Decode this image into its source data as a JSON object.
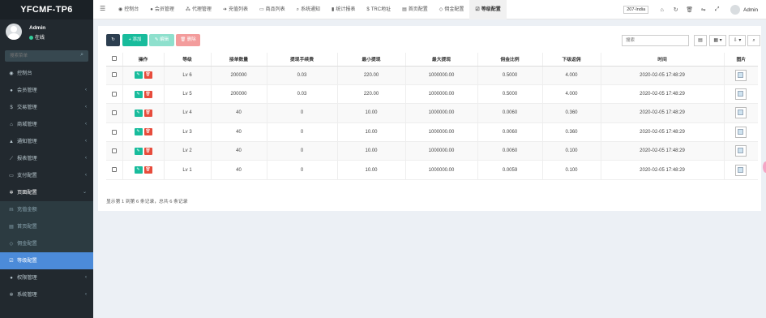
{
  "app": {
    "logo": "YFCMF-TP6"
  },
  "user": {
    "name": "Admin",
    "status": "在线"
  },
  "sidebar": {
    "search_placeholder": "搜索菜单",
    "items": [
      {
        "label": "控制台",
        "icon": "dashboard-icon",
        "glyph": "◉",
        "chevron": ""
      },
      {
        "label": "会员管理",
        "icon": "user-icon",
        "glyph": "●",
        "chevron": "‹"
      },
      {
        "label": "交易管理",
        "icon": "dollar-icon",
        "glyph": "$",
        "chevron": "‹"
      },
      {
        "label": "商城管理",
        "icon": "home-icon",
        "glyph": "⌂",
        "chevron": "‹"
      },
      {
        "label": "通知管理",
        "icon": "bell-icon",
        "glyph": "▲",
        "chevron": "‹"
      },
      {
        "label": "报表管理",
        "icon": "chart-icon",
        "glyph": "⟋",
        "chevron": "‹"
      },
      {
        "label": "支付配置",
        "icon": "card-icon",
        "glyph": "▭",
        "chevron": "‹"
      },
      {
        "label": "页面配置",
        "icon": "gear-icon",
        "glyph": "✲",
        "chevron": "⌄"
      }
    ],
    "subitems": [
      {
        "label": "充值金额",
        "icon": "money-icon",
        "glyph": "m"
      },
      {
        "label": "首页配置",
        "icon": "list-icon",
        "glyph": "▤"
      },
      {
        "label": "佣金配置",
        "icon": "diamond-icon",
        "glyph": "◇"
      },
      {
        "label": "等级配置",
        "icon": "check-square-icon",
        "glyph": "☑"
      }
    ],
    "bottom_items": [
      {
        "label": "权限管理",
        "icon": "group-icon",
        "glyph": "●",
        "chevron": "‹"
      },
      {
        "label": "系统管理",
        "icon": "cogs-icon",
        "glyph": "✲",
        "chevron": "‹"
      }
    ]
  },
  "topbar": {
    "tabs": [
      {
        "label": "控制台",
        "glyph": "◉"
      },
      {
        "label": "会员管理",
        "glyph": "●"
      },
      {
        "label": "代理管理",
        "glyph": "⁂"
      },
      {
        "label": "充值列表",
        "glyph": "➔"
      },
      {
        "label": "商品列表",
        "glyph": "▭"
      },
      {
        "label": "系统通知",
        "glyph": "⌕"
      },
      {
        "label": "统计报表",
        "glyph": "▮"
      },
      {
        "label": "TRC地址",
        "glyph": "$"
      },
      {
        "label": "首页配置",
        "glyph": "▤"
      },
      {
        "label": "佣金配置",
        "glyph": "◇"
      },
      {
        "label": "等级配置",
        "glyph": "☑"
      }
    ],
    "region": "207-India",
    "user": "Admin"
  },
  "toolbar": {
    "refresh": "↻",
    "add": "+ 添加",
    "edit": "✎ 编辑",
    "delete": "🗑 删除",
    "search_placeholder": "搜索",
    "view_toggle": "▤",
    "columns": "▦ ▾",
    "export": "⇩ ▾",
    "search_btn": "⌕"
  },
  "table": {
    "headers": [
      "",
      "操作",
      "等级",
      "接单数量",
      "提现手续费",
      "最小提现",
      "最大提现",
      "佣金比例",
      "下级返佣",
      "时间",
      "图片"
    ],
    "rows": [
      {
        "level": "Lv 6",
        "orders": "200000",
        "fee": "0.03",
        "min": "220.00",
        "max": "1000000.00",
        "rate": "0.5000",
        "sub": "4.000",
        "time": "2020-02-05 17:48:29"
      },
      {
        "level": "Lv 5",
        "orders": "200000",
        "fee": "0.03",
        "min": "220.00",
        "max": "1000000.00",
        "rate": "0.5000",
        "sub": "4.000",
        "time": "2020-02-05 17:48:29"
      },
      {
        "level": "Lv 4",
        "orders": "40",
        "fee": "0",
        "min": "10.00",
        "max": "1000000.00",
        "rate": "0.0060",
        "sub": "0.360",
        "time": "2020-02-05 17:48:29"
      },
      {
        "level": "Lv 3",
        "orders": "40",
        "fee": "0",
        "min": "10.00",
        "max": "1000000.00",
        "rate": "0.0060",
        "sub": "0.360",
        "time": "2020-02-05 17:48:29"
      },
      {
        "level": "Lv 2",
        "orders": "40",
        "fee": "0",
        "min": "10.00",
        "max": "1000000.00",
        "rate": "0.0060",
        "sub": "0.100",
        "time": "2020-02-05 17:48:29"
      },
      {
        "level": "Lv 1",
        "orders": "40",
        "fee": "0",
        "min": "10.00",
        "max": "1000000.00",
        "rate": "0.0059",
        "sub": "0.100",
        "time": "2020-02-05 17:48:29"
      }
    ]
  },
  "pagination": {
    "summary": "显示第 1 到第 6 条记录，总共 6 条记录"
  },
  "colors": {
    "sidebar_bg": "#22292f",
    "active_item": "#4c8bd9",
    "add_green": "#18bc9c",
    "delete_red": "#e74c3c"
  }
}
